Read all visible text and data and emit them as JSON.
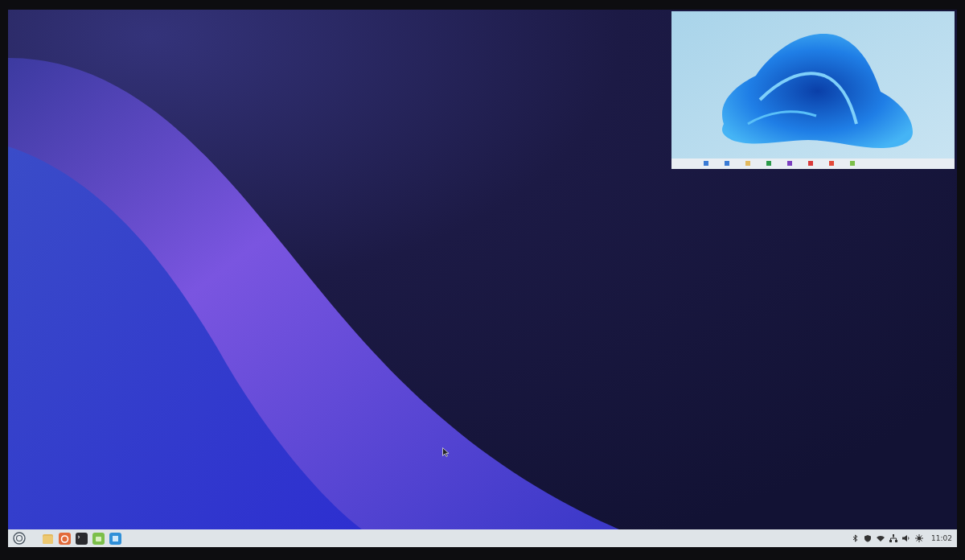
{
  "taskbar": {
    "clock": "11:02"
  }
}
